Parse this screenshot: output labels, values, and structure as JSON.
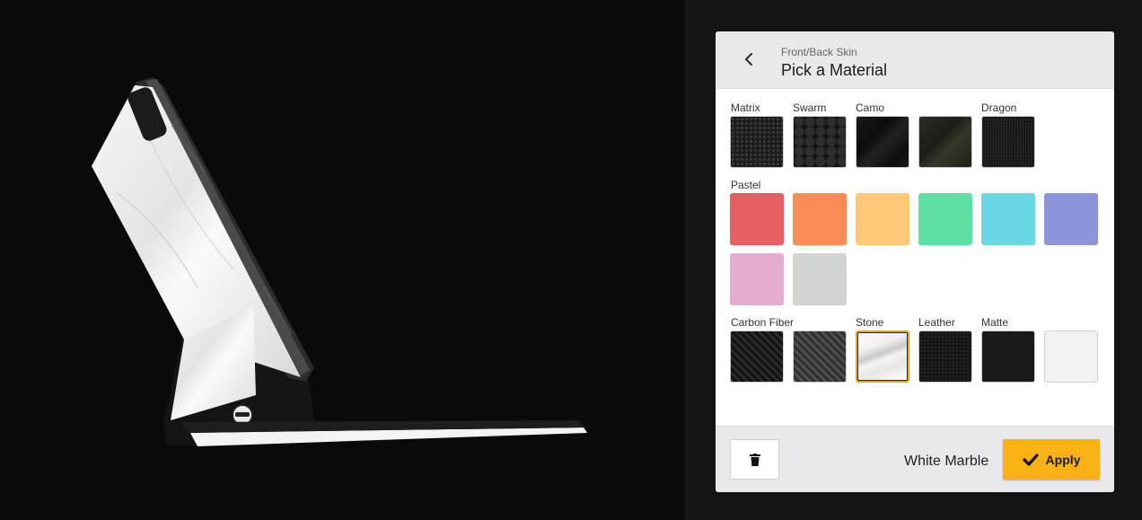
{
  "header": {
    "subtitle": "Front/Back Skin",
    "title": "Pick a Material"
  },
  "groups": {
    "matrix": "Matrix",
    "swarm": "Swarm",
    "camo": "Camo",
    "dragon": "Dragon",
    "pastel": "Pastel",
    "carbon_fiber": "Carbon Fiber",
    "stone": "Stone",
    "leather": "Leather",
    "matte": "Matte"
  },
  "pastel_colors": [
    "#e65f63",
    "#fd8b56",
    "#ffc979",
    "#5edfa4",
    "#6ad8e4",
    "#8c95dc",
    "#e6acd0",
    "#d1d3cf"
  ],
  "selected_material": "White Marble",
  "footer": {
    "apply_label": "Apply"
  },
  "icons": {
    "back": "chevron-left-icon",
    "delete": "trash-icon",
    "apply": "checkmark-icon"
  },
  "colors": {
    "accent": "#f9b214",
    "panel_header": "#e9e9eb",
    "stage_background": "#0a0a0a"
  }
}
